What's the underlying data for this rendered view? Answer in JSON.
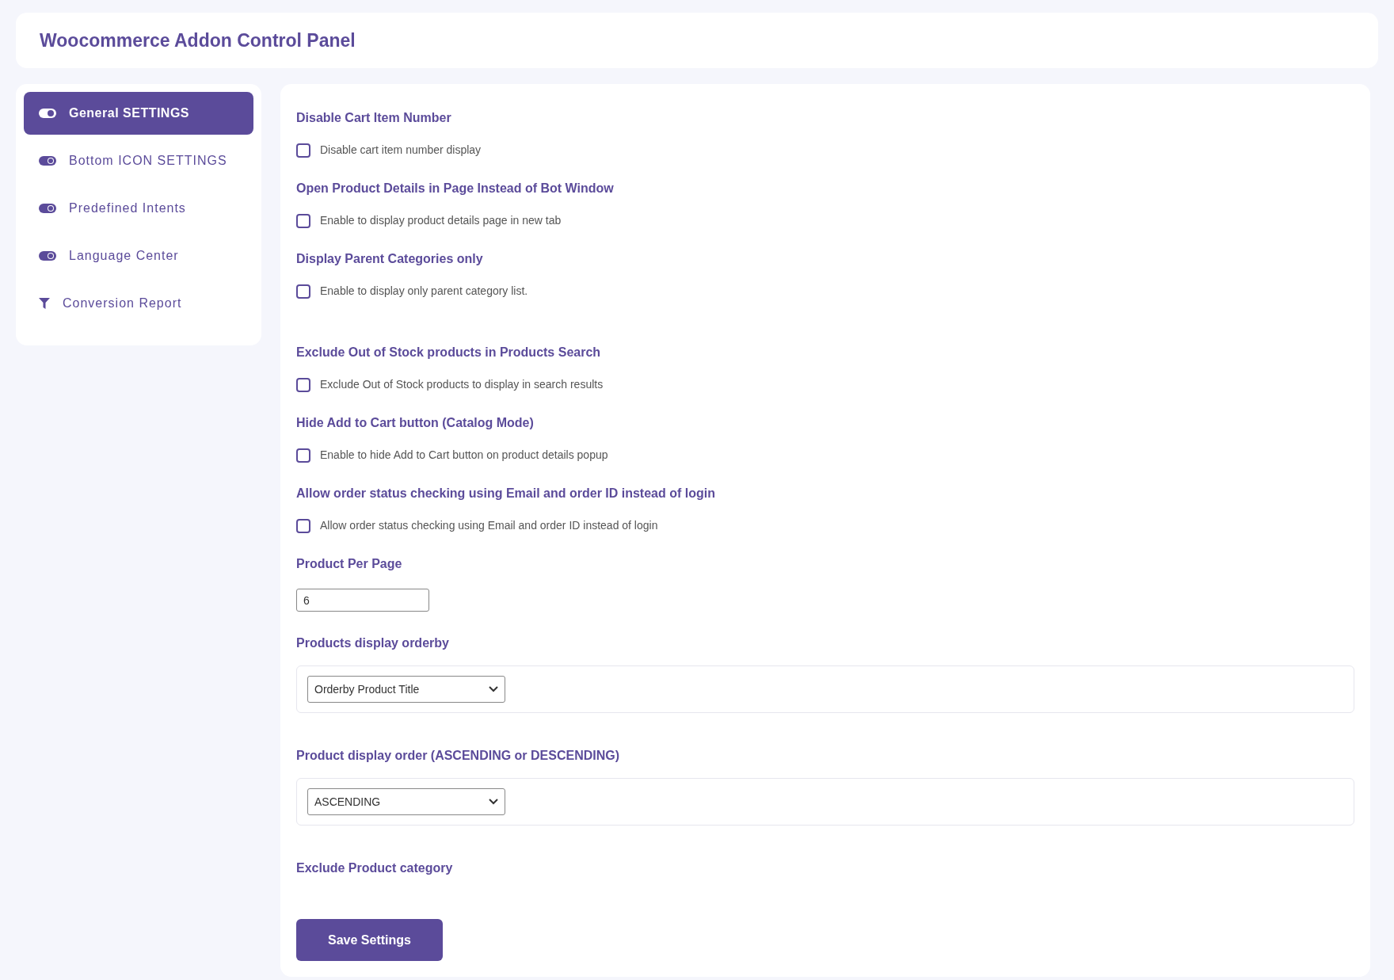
{
  "header": {
    "title": "Woocommerce Addon Control Panel"
  },
  "sidebar": {
    "items": [
      {
        "label": "General SETTINGS",
        "kind": "toggle",
        "selected": true
      },
      {
        "label": "Bottom ICON SETTINGS",
        "kind": "toggle",
        "selected": false
      },
      {
        "label": "Predefined Intents",
        "kind": "toggle",
        "selected": false
      },
      {
        "label": "Language Center",
        "kind": "toggle",
        "selected": false
      },
      {
        "label": "Conversion Report",
        "kind": "filter",
        "selected": false
      }
    ]
  },
  "settings": [
    {
      "kind": "checkbox",
      "title": "Disable Cart Item Number",
      "label": "Disable cart item number display",
      "checked": false
    },
    {
      "kind": "checkbox",
      "title": "Open Product Details in Page Instead of Bot Window",
      "label": "Enable to display product details page in new tab",
      "checked": false
    },
    {
      "kind": "checkbox",
      "title": "Display Parent Categories only",
      "label": "Enable to display only parent category list.",
      "checked": false
    },
    {
      "kind": "checkbox",
      "title": "Exclude Out of Stock products in Products Search",
      "label": "Exclude Out of Stock products to display in search results",
      "checked": false
    },
    {
      "kind": "checkbox",
      "title": "Hide Add to Cart button (Catalog Mode)",
      "label": "Enable to hide Add to Cart button on product details popup",
      "checked": false
    },
    {
      "kind": "checkbox",
      "title": "Allow order status checking using Email and order ID instead of login",
      "label": "Allow order status checking using Email and order ID instead of login",
      "checked": false
    },
    {
      "kind": "number",
      "title": "Product Per Page",
      "value": "6"
    },
    {
      "kind": "select",
      "title": "Products display orderby",
      "value": "Orderby Product Title"
    },
    {
      "kind": "select",
      "title": "Product display order (ASCENDING or DESCENDING)",
      "value": "ASCENDING"
    },
    {
      "kind": "heading",
      "title": "Exclude Product category"
    }
  ],
  "save_button": {
    "label": "Save Settings"
  }
}
